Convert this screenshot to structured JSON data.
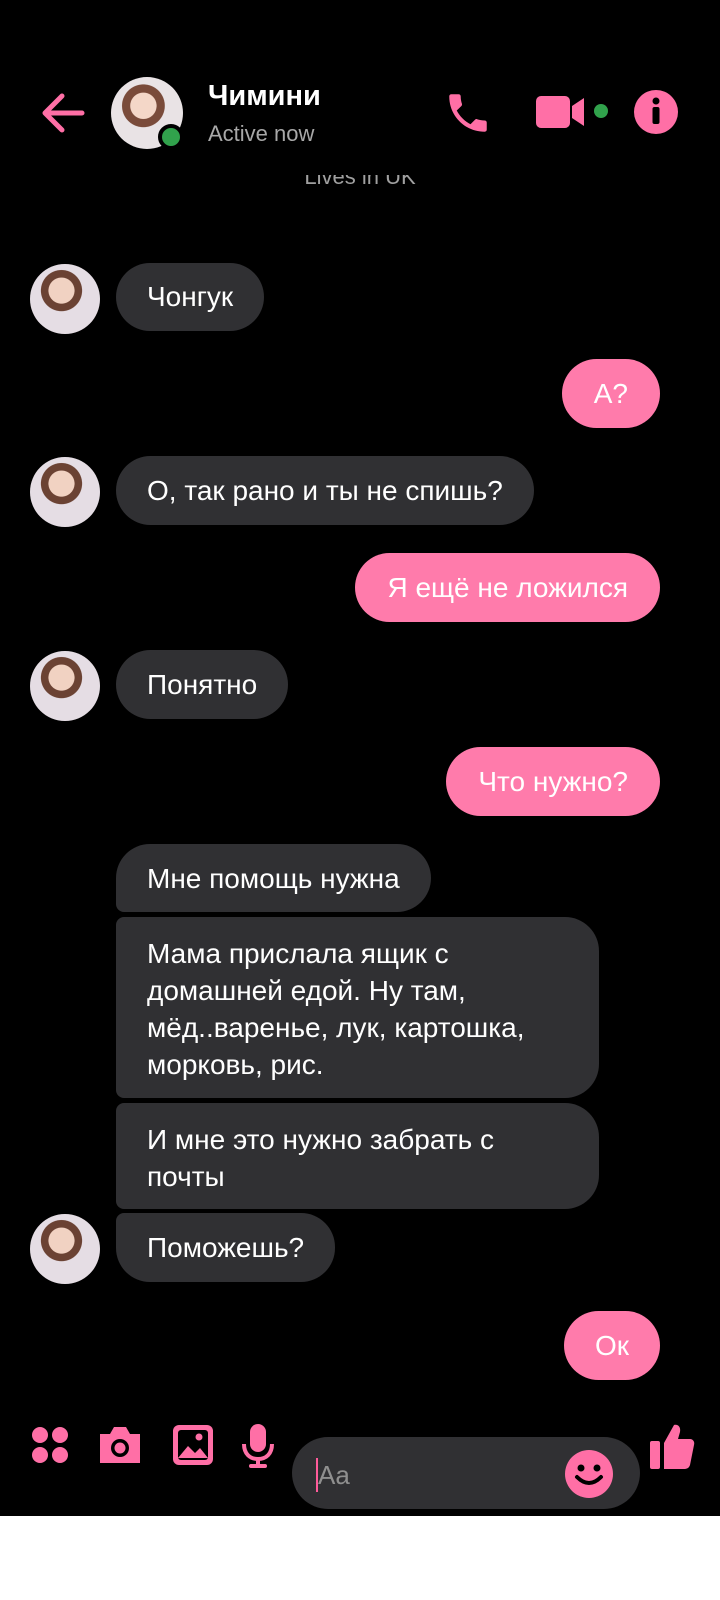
{
  "header": {
    "name": "Чимини",
    "status": "Active now",
    "profile_peek": "Lives in UK"
  },
  "messages": [
    {
      "side": "in",
      "text": "Чонгук"
    },
    {
      "side": "out",
      "text": "А?"
    },
    {
      "side": "in",
      "text": "О, так рано и ты не спишь?"
    },
    {
      "side": "out",
      "text": "Я ещё не ложился"
    },
    {
      "side": "in",
      "text": "Понятно"
    },
    {
      "side": "out",
      "text": "Что нужно?"
    },
    {
      "side": "in",
      "text": "Мне помощь нужна"
    },
    {
      "side": "in",
      "text": "Мама прислала ящик с домашней едой. Ну там, мёд..варенье, лук, картошка, морковь, рис."
    },
    {
      "side": "in",
      "text": "И мне это нужно забрать с почты"
    },
    {
      "side": "in",
      "text": "Поможешь?"
    },
    {
      "side": "out",
      "text": "Ок"
    }
  ],
  "composer": {
    "placeholder": "Aa"
  },
  "colors": {
    "accent": "#ff6fa6",
    "incoming_bubble": "#303033",
    "outgoing_bubble": "#ff7bab",
    "online": "#31a24c"
  }
}
